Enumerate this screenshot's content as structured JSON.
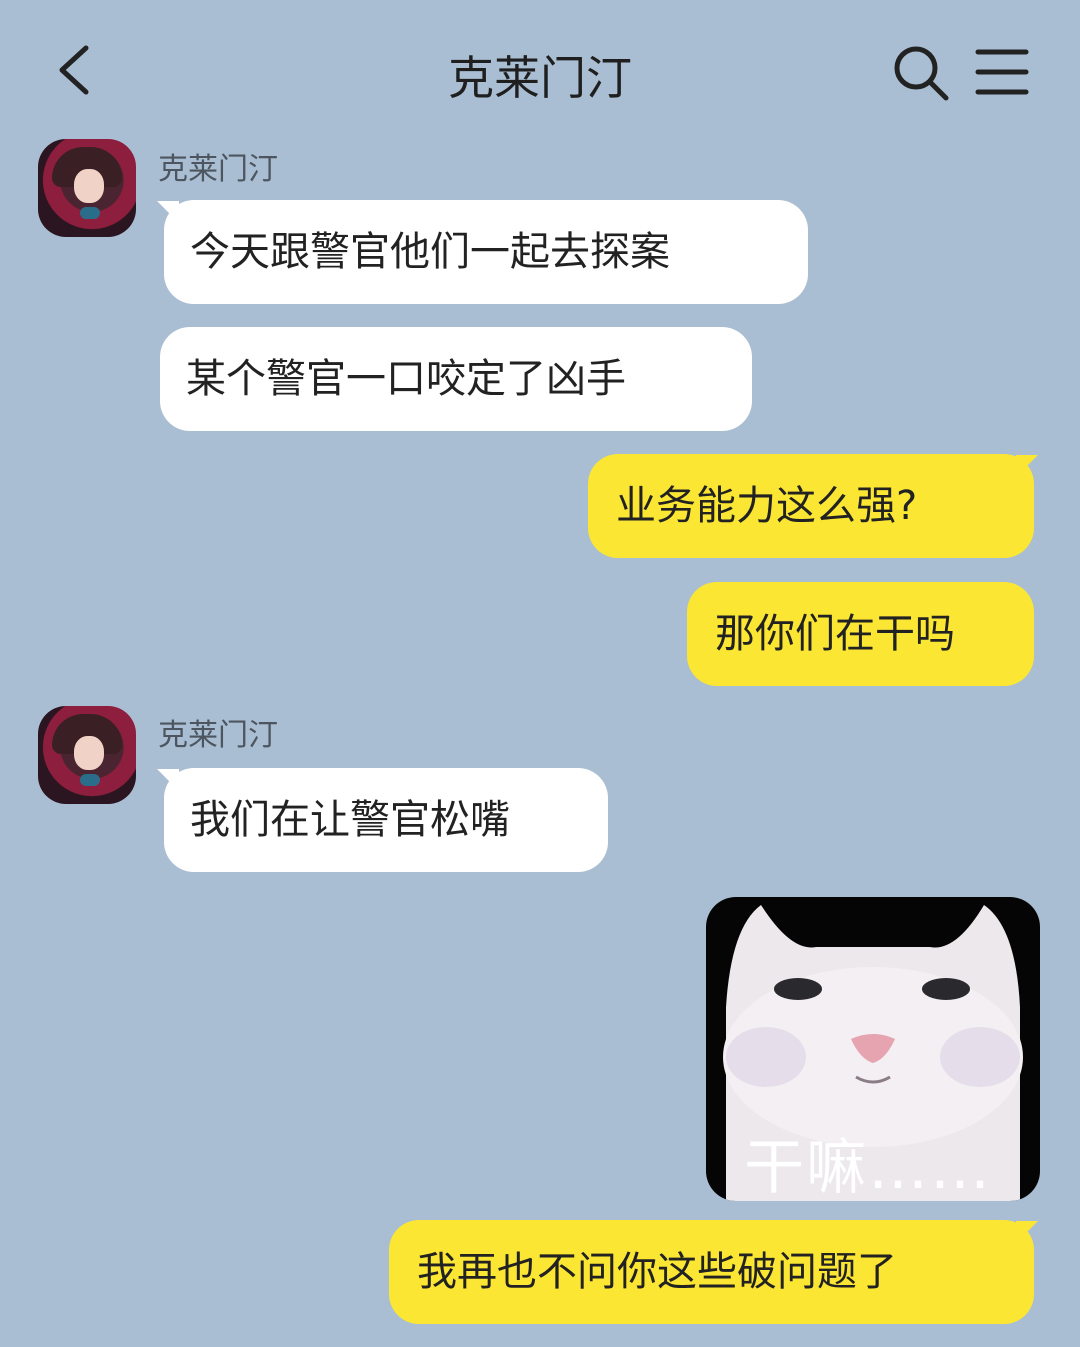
{
  "header": {
    "title": "克莱门汀",
    "back_icon": "chevron-left-icon",
    "search_icon": "search-icon",
    "menu_icon": "menu-icon"
  },
  "colors": {
    "background": "#a9bed2",
    "incoming_bubble": "#ffffff",
    "outgoing_bubble": "#fbe633"
  },
  "messages": [
    {
      "sender": "克莱门汀",
      "side": "left",
      "text": "今天跟警官他们一起去探案"
    },
    {
      "side": "left",
      "text": "某个警官一口咬定了凶手"
    },
    {
      "side": "right",
      "text": "业务能力这么强?"
    },
    {
      "side": "right",
      "text": "那你们在干吗"
    },
    {
      "sender": "克莱门汀",
      "side": "left",
      "text": "我们在让警官松嘴"
    },
    {
      "side": "right",
      "type": "sticker",
      "caption": "干嘛……"
    },
    {
      "side": "right",
      "text": "我再也不问你这些破问题了"
    }
  ]
}
